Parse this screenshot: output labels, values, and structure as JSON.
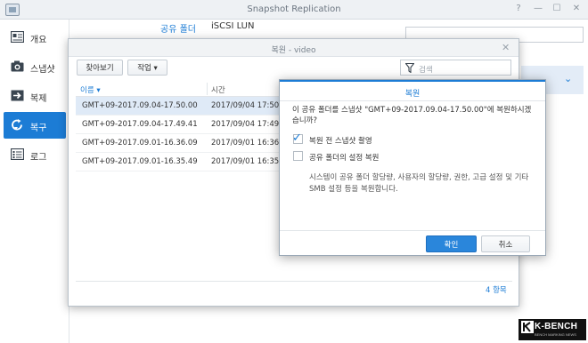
{
  "app": {
    "title": "Snapshot Replication",
    "window_controls": [
      "?",
      "—",
      "☐",
      "✕"
    ]
  },
  "sidebar": {
    "items": [
      {
        "label": "개요",
        "icon": "overview-card-icon",
        "active": false
      },
      {
        "label": "스냅샷",
        "icon": "camera-icon",
        "active": false
      },
      {
        "label": "복제",
        "icon": "replication-icon",
        "active": false
      },
      {
        "label": "복구",
        "icon": "recovery-icon",
        "active": true
      },
      {
        "label": "로그",
        "icon": "log-list-icon",
        "active": false
      }
    ]
  },
  "tabs": [
    {
      "label": "공유 폴더",
      "active": true
    },
    {
      "label": "iSCSI LUN",
      "active": false
    }
  ],
  "restore_window": {
    "title": "복원 - video",
    "close_glyph": "✕",
    "toolbar": {
      "browse_label": "찾아보기",
      "action_label": "작업 ▾",
      "filter_placeholder": "검색"
    },
    "columns": {
      "name": "이름 ▾",
      "time": "시간"
    },
    "rows": [
      {
        "name": "GMT+09-2017.09.04-17.50.00",
        "time": "2017/09/04 17:50",
        "selected": true
      },
      {
        "name": "GMT+09-2017.09.04-17.49.41",
        "time": "2017/09/04 17:49",
        "selected": false
      },
      {
        "name": "GMT+09-2017.09.01-16.36.09",
        "time": "2017/09/01 16:36",
        "selected": false
      },
      {
        "name": "GMT+09-2017.09.01-16.35.49",
        "time": "2017/09/01 16:35",
        "selected": false
      }
    ],
    "item_count": "4 항목"
  },
  "dialog": {
    "title": "복원",
    "message": "이 공유 폴더를 스냅샷 \"GMT+09-2017.09.04-17.50.00\"에 복원하시겠습니까?",
    "options": [
      {
        "label": "복원 전 스냅샷 촬영",
        "checked": true
      },
      {
        "label": "공유 폴더의 설정 복원",
        "checked": false
      }
    ],
    "description": "시스템이 공유 폴더 할당량, 사용자의 할당량, 권한, 고급 설정 및 기타 SMB 설정 등을 복원합니다.",
    "ok_label": "확인",
    "cancel_label": "취소"
  },
  "watermark": {
    "text": "K-BENCH",
    "sub": "BENCH MARKING NEWS"
  },
  "colors": {
    "accent": "#1c7cd5",
    "selected_row": "#dfeaf7"
  }
}
